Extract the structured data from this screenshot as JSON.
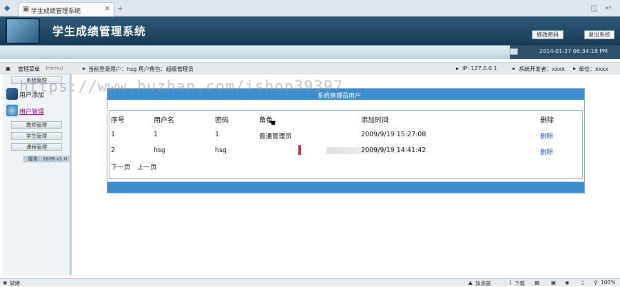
{
  "browser": {
    "tab_title": "学生成绩管理系统",
    "close": "×",
    "new_tab": "+"
  },
  "header": {
    "title": "学生成绩管理系统",
    "change_password": "修改密码",
    "logout": "退出系统",
    "datetime": "2014-01-27 06:34:18 PM"
  },
  "infobar": {
    "menu_label": "管理菜单",
    "menu_sub": "(menu)",
    "current_user": "当前登录用户：hsg  用户角色：超级管理员",
    "ip": "IP: 127.0.0.1",
    "developer": "系统开发者：xxxx",
    "unit": "单位：xxxx"
  },
  "sidebar": {
    "system_manage": "系统管理",
    "user_mod": "用户添加",
    "user_manage": "用户管理",
    "teacher_manage": "教师管理",
    "student_manage": "学生管理",
    "course_manage": "课程管理",
    "version": "版本：2009 v1.0"
  },
  "panel": {
    "title": "系统管理员用户",
    "columns": [
      "序号",
      "用户名",
      "密码",
      "角色",
      "添加时间",
      "删除"
    ],
    "rows": [
      {
        "id": "1",
        "username": "1",
        "password": "1",
        "role": "普通管理员",
        "time": "2009/9/19 15:27:08",
        "action": "删除"
      },
      {
        "id": "2",
        "username": "hsg",
        "password": "hsg",
        "role": "",
        "time": "2009/9/19 14:41:42",
        "action": "删除"
      }
    ],
    "next_page": "下一页",
    "prev_page": "上一页"
  },
  "watermark": "https://www.huzhan.com/ishop39397",
  "statusbar": {
    "left": "就绪",
    "accel": "加速器",
    "download": "下载",
    "zoom": "100%"
  },
  "colors": {
    "header_bg": "#1f4a66",
    "panel_head": "#3d8ccc",
    "link": "#1a56c4"
  }
}
